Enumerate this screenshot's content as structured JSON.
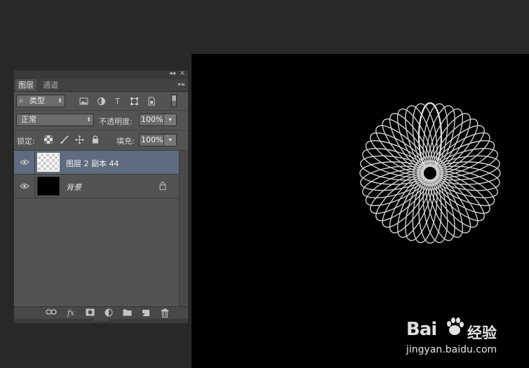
{
  "layers_panel": {
    "tabs": [
      {
        "label": "图层",
        "active": true
      },
      {
        "label": "通道",
        "active": false
      }
    ],
    "collapse_glyph": "◂◂",
    "close_glyph": "×",
    "menu_glyph": "▾≡",
    "filter": {
      "search_glyph": "⌕",
      "label": "类型",
      "arrow": "⬍"
    },
    "filter_icons": [
      "image-filter-icon",
      "adjustment-filter-icon",
      "type-filter-icon",
      "shape-filter-icon",
      "smart-object-filter-icon"
    ],
    "filter_type_glyph": "T",
    "blend_mode": "正常",
    "opacity_label": "不透明度:",
    "opacity_value": "100%",
    "lock_label": "锁定:",
    "lock_icons": [
      "lock-transparent-pixels-icon",
      "lock-image-pixels-icon",
      "lock-position-icon",
      "lock-all-icon"
    ],
    "fill_label": "填充:",
    "fill_value": "100%",
    "dropdown_glyph": "▾",
    "layers": [
      {
        "name": "图层 2 副本 44",
        "selected": true,
        "visible": true,
        "thumbnail": "transparent",
        "locked": false
      },
      {
        "name": "背景",
        "selected": false,
        "visible": true,
        "thumbnail": "black",
        "locked": true
      }
    ],
    "bottom_icons": [
      "link-layers-icon",
      "fx-icon",
      "add-mask-icon",
      "adjustment-layer-icon",
      "new-group-icon",
      "new-layer-icon",
      "delete-layer-icon"
    ],
    "fx_label": "fx"
  },
  "watermark": {
    "logo_text": "Bai",
    "logo_text2": "经验",
    "url": "jingyan.baidu.com"
  }
}
